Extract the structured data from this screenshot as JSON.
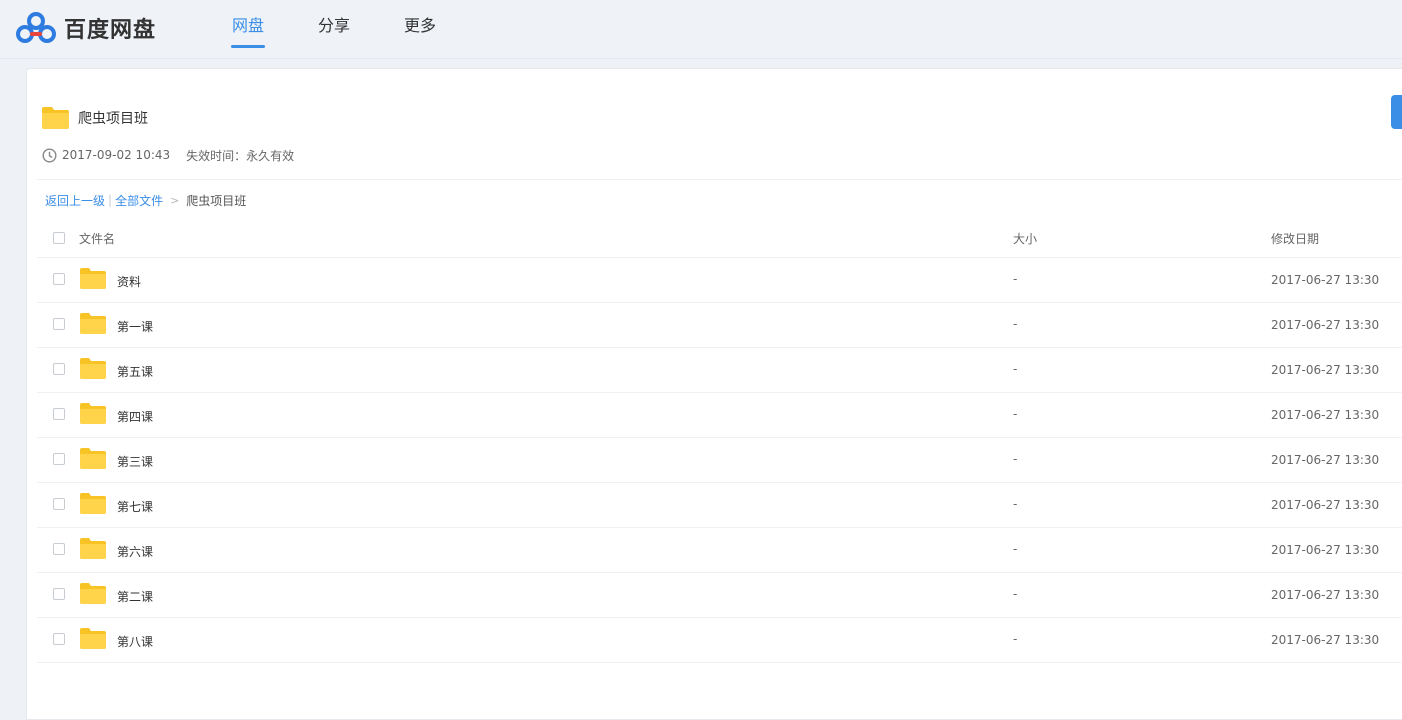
{
  "header": {
    "brand": "百度网盘",
    "nav": [
      {
        "label": "网盘",
        "active": true
      },
      {
        "label": "分享",
        "active": false
      },
      {
        "label": "更多",
        "active": false
      }
    ]
  },
  "share": {
    "title": "爬虫项目班",
    "date": "2017-09-02 10:43",
    "expire": "失效时间：永久有效"
  },
  "breadcrumb": {
    "back": "返回上一级",
    "all": "全部文件",
    "separator": "|",
    "arrow": ">",
    "current": "爬虫项目班"
  },
  "table": {
    "columns": {
      "name": "文件名",
      "size": "大小",
      "date": "修改日期"
    },
    "rows": [
      {
        "name": "资料",
        "size": "-",
        "date": "2017-06-27 13:30"
      },
      {
        "name": "第一课",
        "size": "-",
        "date": "2017-06-27 13:30"
      },
      {
        "name": "第五课",
        "size": "-",
        "date": "2017-06-27 13:30"
      },
      {
        "name": "第四课",
        "size": "-",
        "date": "2017-06-27 13:30"
      },
      {
        "name": "第三课",
        "size": "-",
        "date": "2017-06-27 13:30"
      },
      {
        "name": "第七课",
        "size": "-",
        "date": "2017-06-27 13:30"
      },
      {
        "name": "第六课",
        "size": "-",
        "date": "2017-06-27 13:30"
      },
      {
        "name": "第二课",
        "size": "-",
        "date": "2017-06-27 13:30"
      },
      {
        "name": "第八课",
        "size": "-",
        "date": "2017-06-27 13:30"
      }
    ]
  },
  "icons": {
    "logo": "baidu-cloud-logo-icon",
    "folder": "folder-icon",
    "clock": "clock-icon"
  },
  "colors": {
    "accent": "#3a8ee6",
    "folder": "#ffd44a",
    "background": "#eef2f7"
  }
}
